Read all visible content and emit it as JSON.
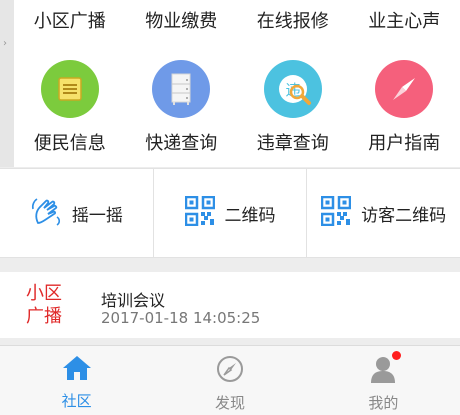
{
  "top_links": [
    "小区广播",
    "物业缴费",
    "在线报修",
    "业主心声"
  ],
  "services": [
    {
      "label": "便民信息",
      "icon": "notes-icon",
      "color": "#7ccb3d"
    },
    {
      "label": "快递查询",
      "icon": "cabinet-icon",
      "color": "#6f9ae8"
    },
    {
      "label": "违章查询",
      "icon": "violation-icon",
      "color": "#4cc2e0"
    },
    {
      "label": "用户指南",
      "icon": "compass-icon",
      "color": "#f5607c"
    }
  ],
  "actions": [
    {
      "label": "摇一摇",
      "icon": "shake-hand-icon"
    },
    {
      "label": "二维码",
      "icon": "qrcode-icon"
    },
    {
      "label": "访客二维码",
      "icon": "visitor-qrcode-icon"
    }
  ],
  "news": {
    "tag": "小区广播",
    "title": "培训会议",
    "time": "2017-01-18 14:05:25"
  },
  "tabs": [
    {
      "label": "社区",
      "icon": "home-icon",
      "active": true
    },
    {
      "label": "发现",
      "icon": "compass-outline-icon",
      "active": false
    },
    {
      "label": "我的",
      "icon": "user-icon",
      "active": false
    }
  ],
  "colors": {
    "accent": "#2d8fe6",
    "tag_red": "#e02a2a",
    "badge": "#ff1e1e"
  }
}
